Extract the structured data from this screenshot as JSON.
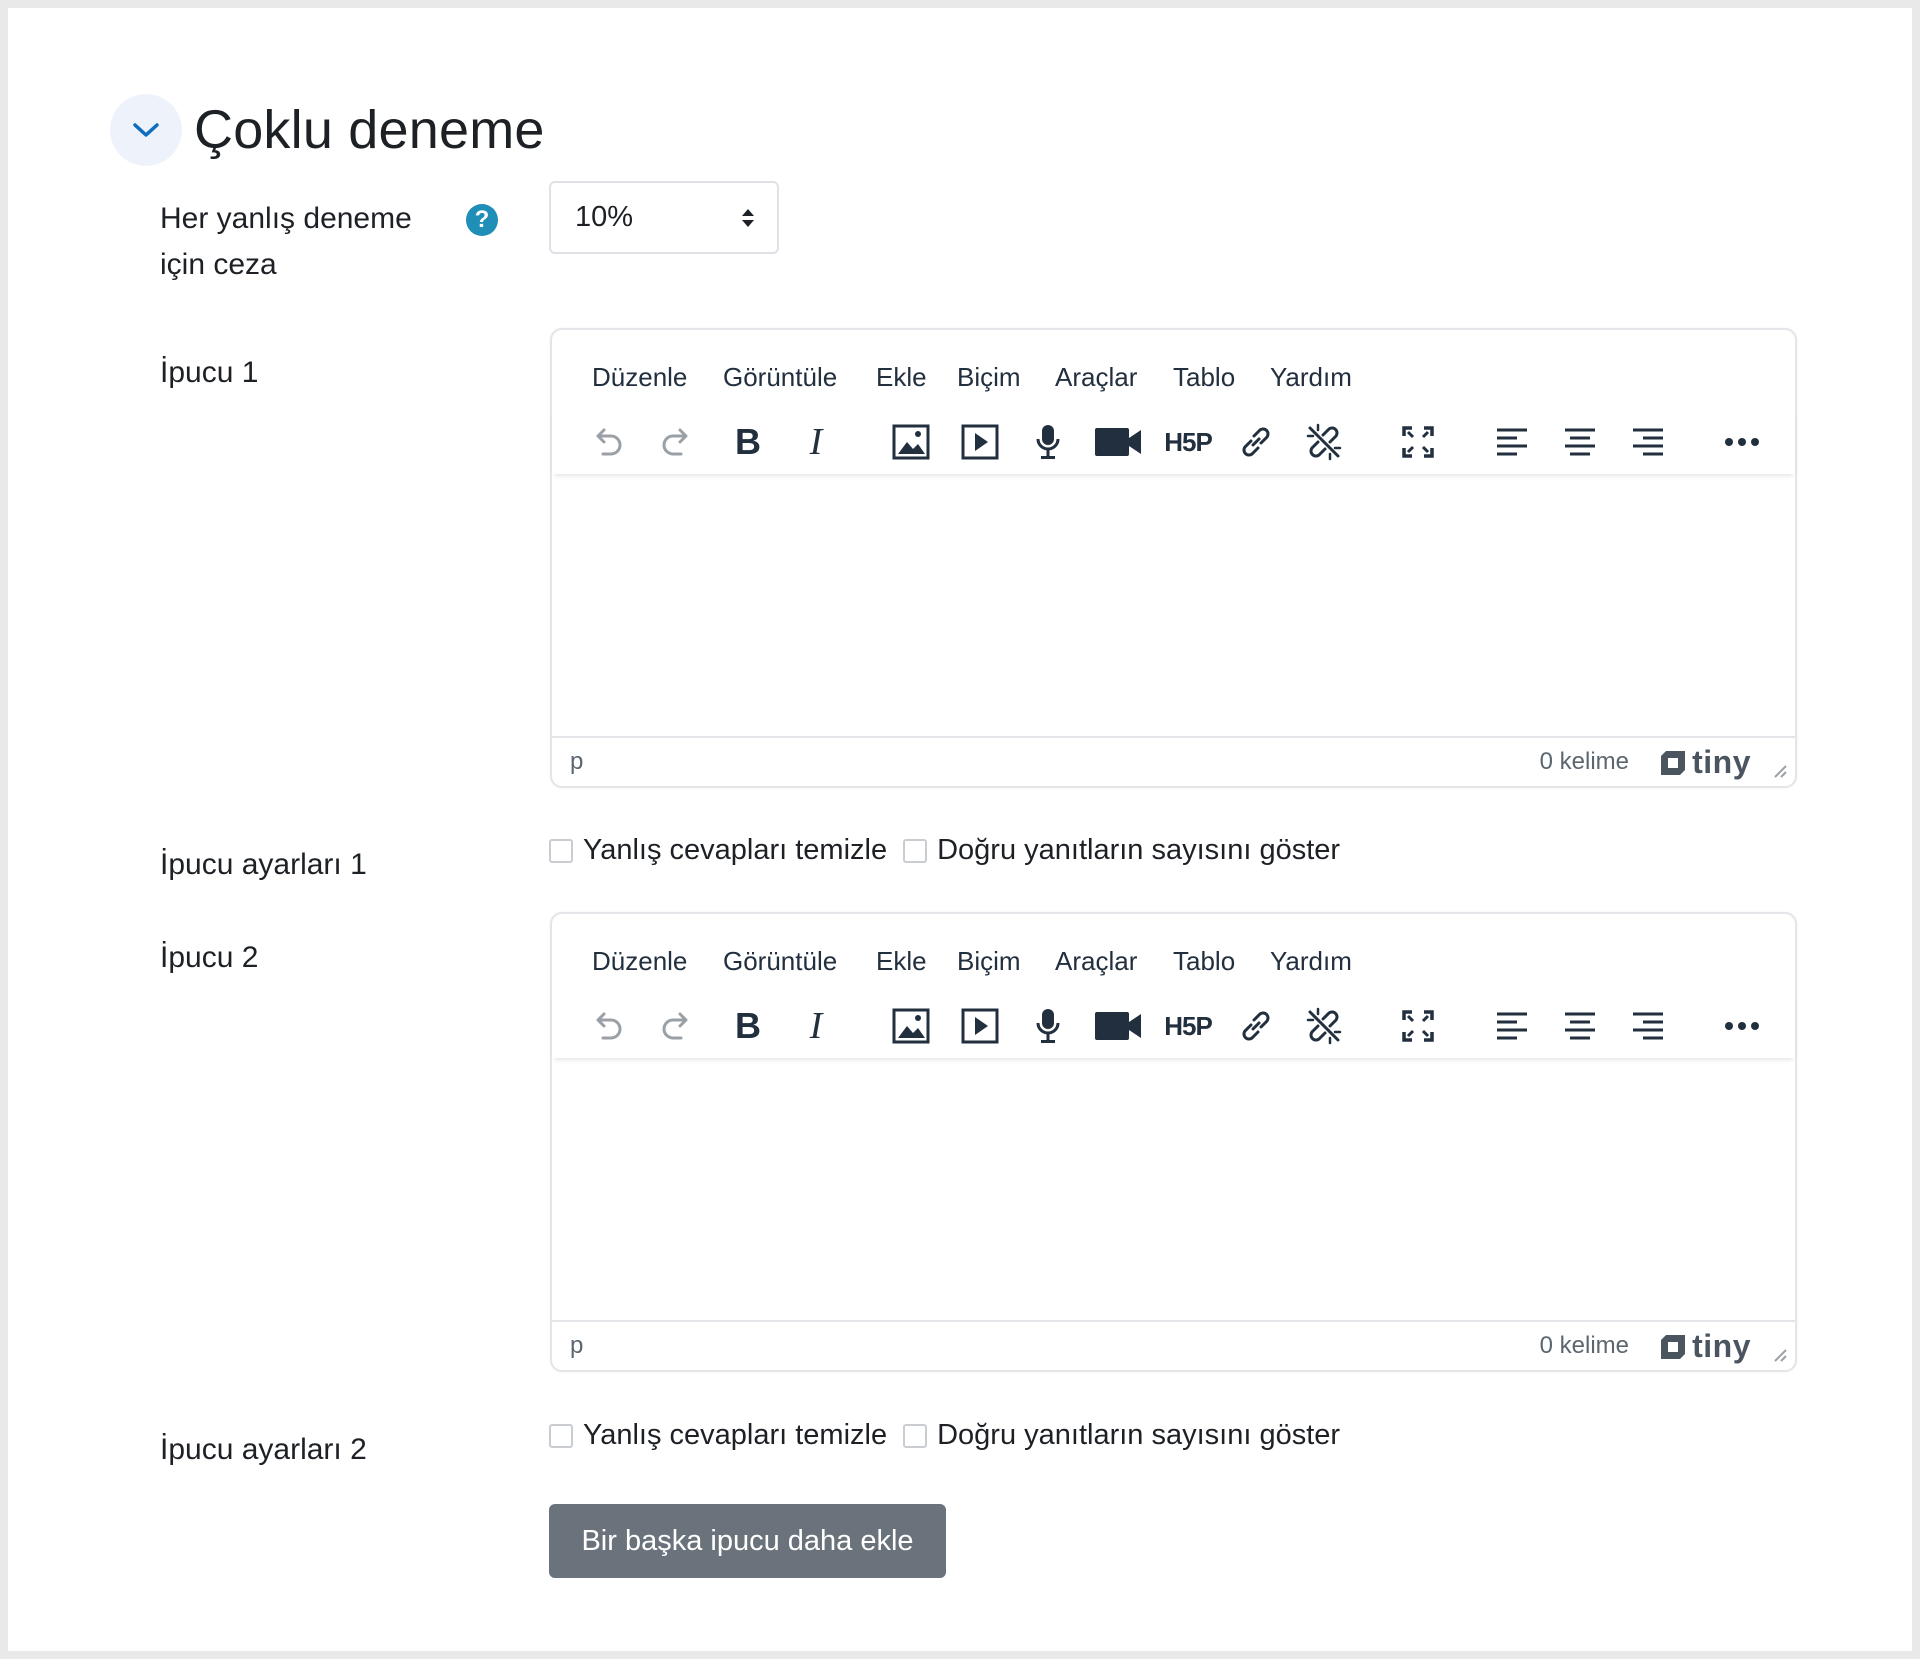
{
  "section": {
    "title": "Çoklu deneme"
  },
  "penalty": {
    "label": "Her yanlış deneme için ceza",
    "value": "10%"
  },
  "editor_menu": [
    "Düzenle",
    "Görüntüle",
    "Ekle",
    "Biçim",
    "Araçlar",
    "Tablo",
    "Yardım"
  ],
  "hints": [
    {
      "label": "İpucu 1",
      "status_path": "p",
      "word_count": "0 kelime",
      "brand": "tiny",
      "settings_label": "İpucu ayarları 1",
      "option_clear": "Yanlış cevapları temizle",
      "option_show": "Doğru yanıtların sayısını göster"
    },
    {
      "label": "İpucu 2",
      "status_path": "p",
      "word_count": "0 kelime",
      "brand": "tiny",
      "settings_label": "İpucu ayarları 2",
      "option_clear": "Yanlış cevapları temizle",
      "option_show": "Doğru yanıtların sayısını göster"
    }
  ],
  "add_button": "Bir başka ipucu daha ekle",
  "toolbar_icons": [
    "undo-icon",
    "redo-icon",
    "bold-icon",
    "italic-icon",
    "image-icon",
    "media-icon",
    "microphone-icon",
    "video-camera-icon",
    "h5p-icon",
    "link-icon",
    "unlink-icon",
    "fullscreen-icon",
    "align-left-icon",
    "align-center-icon",
    "align-right-icon",
    "more-icon"
  ],
  "colors": {
    "help_icon": "#1f8fb8",
    "button": "#6a737b",
    "chevron": "#0f6cbf"
  }
}
